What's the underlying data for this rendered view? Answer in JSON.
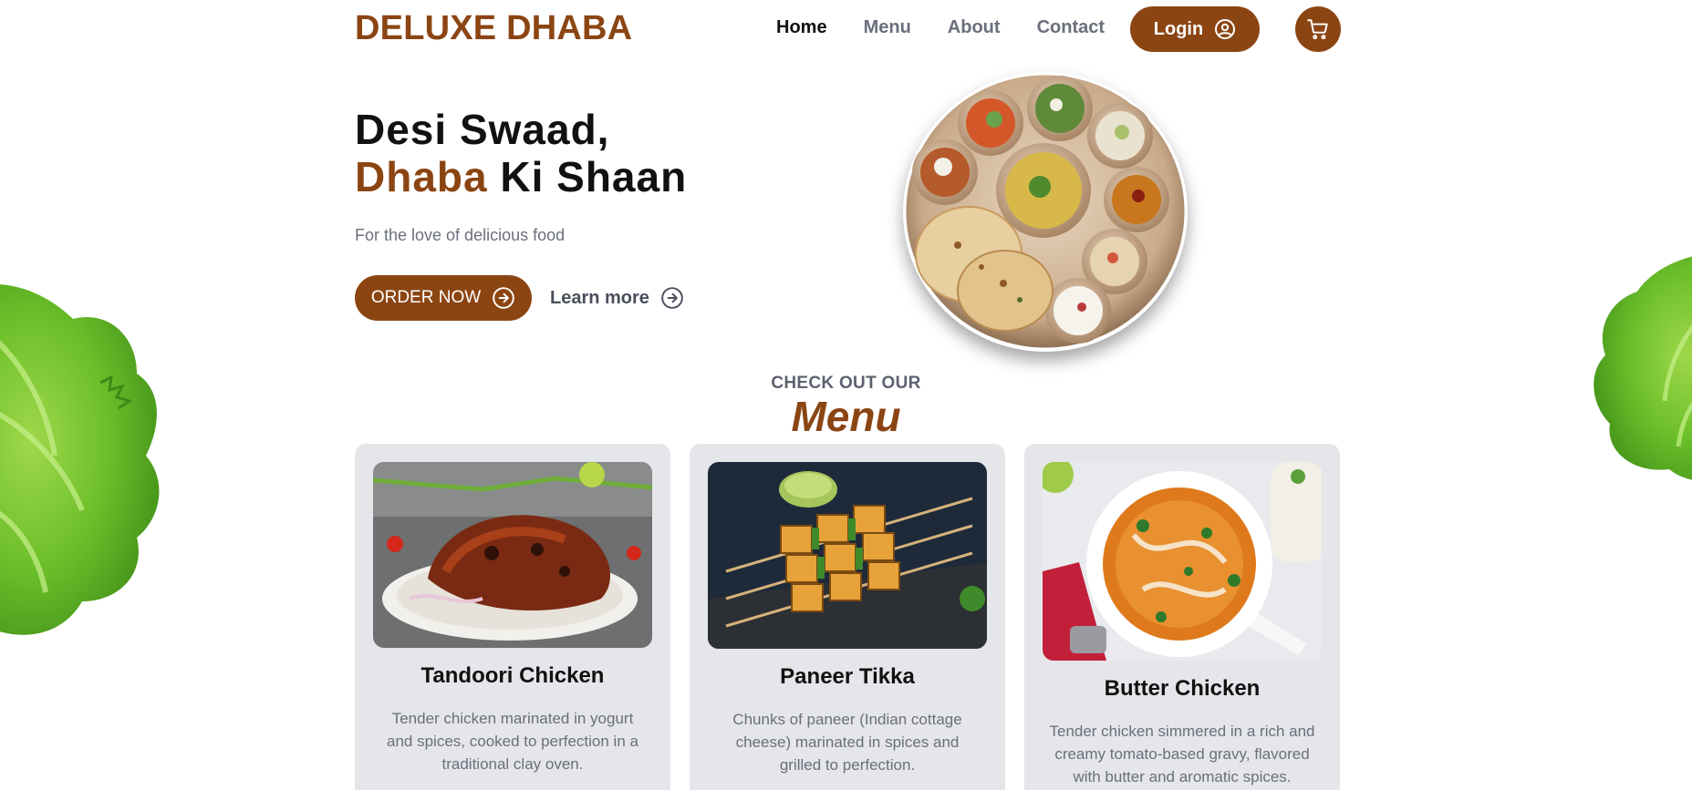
{
  "brand": {
    "name": "DELUXE DHABA",
    "color": "#8B4513"
  },
  "nav": {
    "items": [
      {
        "label": "Home",
        "active": true
      },
      {
        "label": "Menu",
        "active": false
      },
      {
        "label": "About",
        "active": false
      },
      {
        "label": "Contact",
        "active": false
      }
    ],
    "login_label": "Login",
    "login_icon": "user-circle-icon",
    "cart_icon": "cart-icon"
  },
  "hero": {
    "title_line1": "Desi Swaad,",
    "title_accent": "Dhaba",
    "title_rest": " Ki Shaan",
    "tagline": "For the love of delicious food",
    "order_label": "ORDER NOW",
    "learn_label": "Learn more",
    "arrow_icon": "arrow-right-circle-icon"
  },
  "menu_section": {
    "eyebrow": "CHECK OUT OUR",
    "title": "Menu"
  },
  "menu_items": [
    {
      "name": "Tandoori Chicken",
      "description": "Tender chicken marinated in yogurt and spices, cooked to perfection in a traditional clay oven."
    },
    {
      "name": "Paneer Tikka",
      "description": "Chunks of paneer (Indian cottage cheese) marinated in spices and grilled to perfection."
    },
    {
      "name": "Butter Chicken",
      "description": "Tender chicken simmered in a rich and creamy tomato-based gravy, flavored with butter and aromatic spices."
    }
  ]
}
